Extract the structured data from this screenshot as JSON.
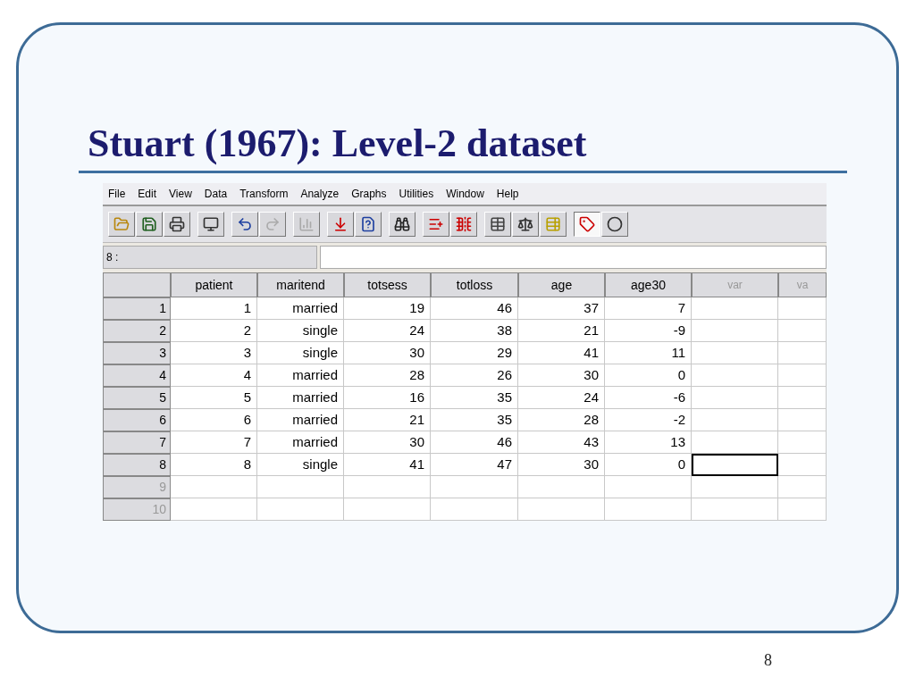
{
  "slide": {
    "title": "Stuart (1967): Level-2 dataset",
    "page_number": "8"
  },
  "window": {
    "menu": [
      "File",
      "Edit",
      "View",
      "Data",
      "Transform",
      "Analyze",
      "Graphs",
      "Utilities",
      "Window",
      "Help"
    ],
    "toolbar_groups": [
      [
        {
          "disabled": false,
          "pressed": false
        },
        {
          "disabled": false,
          "pressed": false
        },
        {
          "disabled": false,
          "pressed": false
        }
      ],
      [
        {
          "disabled": false,
          "pressed": false
        }
      ],
      [
        {
          "disabled": false,
          "pressed": false
        },
        {
          "disabled": true,
          "pressed": false
        }
      ],
      [
        {
          "disabled": true,
          "pressed": false
        }
      ],
      [
        {
          "disabled": false,
          "pressed": false
        },
        {
          "disabled": false,
          "pressed": false
        }
      ],
      [
        {
          "disabled": false,
          "pressed": false
        }
      ],
      [
        {
          "disabled": false,
          "pressed": false
        },
        {
          "disabled": false,
          "pressed": false
        }
      ],
      [
        {
          "disabled": false,
          "pressed": false
        },
        {
          "disabled": false,
          "pressed": false
        },
        {
          "disabled": false,
          "pressed": false
        }
      ],
      [
        {
          "disabled": false,
          "pressed": true
        },
        {
          "disabled": false,
          "pressed": false
        }
      ]
    ],
    "cell_editor": {
      "label": "8 :"
    },
    "grid": {
      "columns": [
        {
          "name": "patient",
          "kind": "variable",
          "selected": false
        },
        {
          "name": "maritend",
          "kind": "variable",
          "selected": false
        },
        {
          "name": "totsess",
          "kind": "variable",
          "selected": false
        },
        {
          "name": "totloss",
          "kind": "variable",
          "selected": false
        },
        {
          "name": "age",
          "kind": "variable",
          "selected": false
        },
        {
          "name": "age30",
          "kind": "variable",
          "selected": false
        },
        {
          "name": "var",
          "kind": "empty",
          "selected": true
        },
        {
          "name": "va",
          "kind": "empty",
          "selected": false
        }
      ],
      "rows": [
        {
          "number": "1",
          "kind": "case",
          "selected": false,
          "cells": [
            "1",
            "married",
            "19",
            "46",
            "37",
            "7"
          ]
        },
        {
          "number": "2",
          "kind": "case",
          "selected": false,
          "cells": [
            "2",
            "single",
            "24",
            "38",
            "21",
            "-9"
          ]
        },
        {
          "number": "3",
          "kind": "case",
          "selected": false,
          "cells": [
            "3",
            "single",
            "30",
            "29",
            "41",
            "11"
          ]
        },
        {
          "number": "4",
          "kind": "case",
          "selected": false,
          "cells": [
            "4",
            "married",
            "28",
            "26",
            "30",
            "0"
          ]
        },
        {
          "number": "5",
          "kind": "case",
          "selected": false,
          "cells": [
            "5",
            "married",
            "16",
            "35",
            "24",
            "-6"
          ]
        },
        {
          "number": "6",
          "kind": "case",
          "selected": false,
          "cells": [
            "6",
            "married",
            "21",
            "35",
            "28",
            "-2"
          ]
        },
        {
          "number": "7",
          "kind": "case",
          "selected": false,
          "cells": [
            "7",
            "married",
            "30",
            "46",
            "43",
            "13"
          ]
        },
        {
          "number": "8",
          "kind": "case",
          "selected": true,
          "cells": [
            "8",
            "single",
            "41",
            "47",
            "30",
            "0"
          ]
        },
        {
          "number": "9",
          "kind": "empty",
          "selected": false,
          "cells": []
        },
        {
          "number": "10",
          "kind": "empty",
          "selected": false,
          "cells": []
        }
      ]
    }
  }
}
